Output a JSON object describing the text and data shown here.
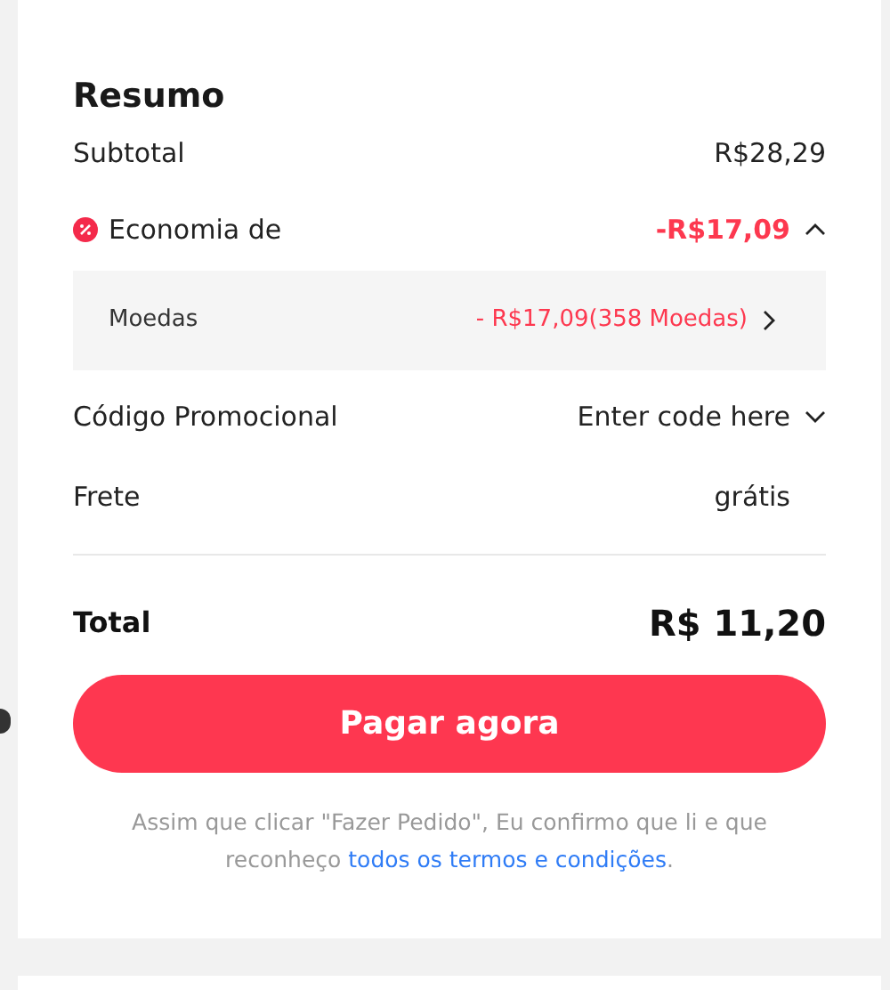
{
  "summary": {
    "title": "Resumo",
    "subtotal": {
      "label": "Subtotal",
      "value": "R$28,29"
    },
    "savings": {
      "label": "Economia de",
      "value": "-R$17,09",
      "expanded": true,
      "items": [
        {
          "label": "Moedas",
          "value": "- R$17,09(358 Moedas)"
        }
      ]
    },
    "promo_code": {
      "label": "Código Promocional",
      "placeholder": "Enter code here"
    },
    "shipping": {
      "label": "Frete",
      "value": "grátis"
    },
    "total": {
      "label": "Total",
      "value": "R$ 11,20"
    },
    "pay_button": "Pagar agora",
    "terms": {
      "text": "Assim que clicar \"Fazer Pedido\", Eu confirmo que li e que reconheço",
      "link": "todos os termos e condições",
      "end": "."
    }
  }
}
